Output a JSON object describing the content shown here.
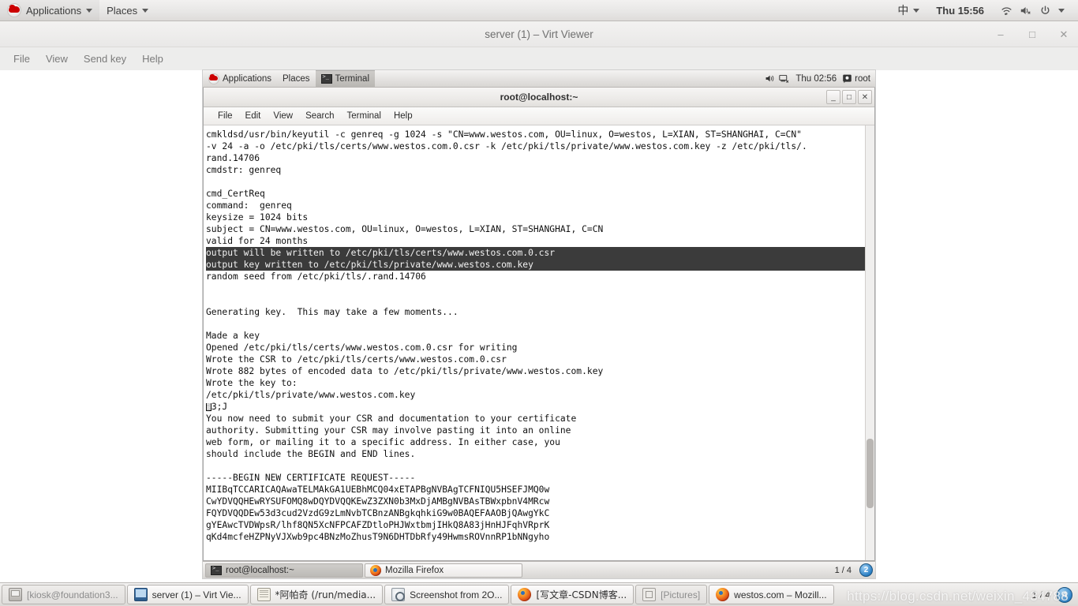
{
  "host_panel": {
    "logo_icon": "redhat-logo-icon",
    "applications_label": "Applications",
    "places_label": "Places",
    "input_method": "中",
    "clock": "Thu 15:56",
    "wifi_icon": "wifi-icon",
    "volume_icon": "volume-muted-icon",
    "power_icon": "power-icon"
  },
  "virt_viewer": {
    "title": "server (1) – Virt Viewer",
    "menu": [
      "File",
      "View",
      "Send key",
      "Help"
    ],
    "window_controls": {
      "minimize": "–",
      "maximize": "□",
      "close": "✕"
    }
  },
  "guest_panel": {
    "applications_label": "Applications",
    "places_label": "Places",
    "active_app": "Terminal",
    "volume_icon": "volume-icon",
    "network_icon": "network-disconnected-icon",
    "clock": "Thu 02:56",
    "user_icon": "user-icon",
    "user": "root"
  },
  "terminal": {
    "title": "root@localhost:~",
    "menu": [
      "File",
      "Edit",
      "View",
      "Search",
      "Terminal",
      "Help"
    ],
    "window_controls": {
      "minimize": "_",
      "maximize": "□",
      "close": "✕"
    },
    "lines": [
      {
        "text": "cmkldsd/usr/bin/keyutil -c genreq -g 1024 -s \"CN=www.westos.com, OU=linux, O=westos, L=XIAN, ST=SHANGHAI, C=CN\"",
        "selected": false
      },
      {
        "text": "-v 24 -a -o /etc/pki/tls/certs/www.westos.com.0.csr -k /etc/pki/tls/private/www.westos.com.key -z /etc/pki/tls/.",
        "selected": false
      },
      {
        "text": "rand.14706",
        "selected": false
      },
      {
        "text": "cmdstr: genreq",
        "selected": false
      },
      {
        "text": "",
        "selected": false
      },
      {
        "text": "cmd_CertReq",
        "selected": false
      },
      {
        "text": "command:  genreq",
        "selected": false
      },
      {
        "text": "keysize = 1024 bits",
        "selected": false
      },
      {
        "text": "subject = CN=www.westos.com, OU=linux, O=westos, L=XIAN, ST=SHANGHAI, C=CN",
        "selected": false
      },
      {
        "text": "valid for 24 months",
        "selected": false
      },
      {
        "text": "output will be written to /etc/pki/tls/certs/www.westos.com.0.csr",
        "selected": true
      },
      {
        "text": "output key written to /etc/pki/tls/private/www.westos.com.key",
        "selected": true
      },
      {
        "text": "random seed from /etc/pki/tls/.rand.14706",
        "selected": false
      },
      {
        "text": "",
        "selected": false
      },
      {
        "text": "",
        "selected": false
      },
      {
        "text": "Generating key.  This may take a few moments...",
        "selected": false
      },
      {
        "text": "",
        "selected": false
      },
      {
        "text": "Made a key",
        "selected": false
      },
      {
        "text": "Opened /etc/pki/tls/certs/www.westos.com.0.csr for writing",
        "selected": false
      },
      {
        "text": "Wrote the CSR to /etc/pki/tls/certs/www.westos.com.0.csr",
        "selected": false
      },
      {
        "text": "Wrote 882 bytes of encoded data to /etc/pki/tls/private/www.westos.com.key",
        "selected": false
      },
      {
        "text": "Wrote the key to:",
        "selected": false
      },
      {
        "text": "/etc/pki/tls/private/www.westos.com.key",
        "selected": false
      },
      {
        "text": "\u00003;J",
        "selected": false,
        "ctrl_prefix": true
      },
      {
        "text": "You now need to submit your CSR and documentation to your certificate",
        "selected": false
      },
      {
        "text": "authority. Submitting your CSR may involve pasting it into an online",
        "selected": false
      },
      {
        "text": "web form, or mailing it to a specific address. In either case, you",
        "selected": false
      },
      {
        "text": "should include the BEGIN and END lines.",
        "selected": false
      },
      {
        "text": "",
        "selected": false
      },
      {
        "text": "-----BEGIN NEW CERTIFICATE REQUEST-----",
        "selected": false
      },
      {
        "text": "MIIBqTCCARICAQAwaTELMAkGA1UEBhMCQ04xETAPBgNVBAgTCFNIQU5HSEFJMQ0w",
        "selected": false
      },
      {
        "text": "CwYDVQQHEwRYSUFOMQ8wDQYDVQQKEwZ3ZXN0b3MxDjAMBgNVBAsTBWxpbnV4MRcw",
        "selected": false
      },
      {
        "text": "FQYDVQQDEw53d3cud2VzdG9zLmNvbTCBnzANBgkqhkiG9w0BAQEFAAOBjQAwgYkC",
        "selected": false
      },
      {
        "text": "gYEAwcTVDWpsR/lhf8QN5XcNFPCAFZDtloPHJWxtbmjIHkQ8A83jHnHJFqhVRprK",
        "selected": false
      },
      {
        "text": "qKd4mcfeHZPNyVJXwb9pc4BNzMoZhusT9N6DHTDbRfy49HwmsROVnnRP1bNNgyho",
        "selected": false
      }
    ],
    "ctrl_char_label": "▓"
  },
  "guest_taskbar": {
    "tasks": [
      {
        "label": "root@localhost:~",
        "icon": "terminal-icon",
        "active": true
      },
      {
        "label": "Mozilla Firefox",
        "icon": "firefox-icon",
        "active": false
      }
    ],
    "workspace_count": "1 / 4",
    "workspace_badge": "2"
  },
  "host_taskbar": {
    "tasks": [
      {
        "label": "[kiosk@foundation3...",
        "icon": "terminal-kiosk-icon",
        "dim": true
      },
      {
        "label": "server (1) – Virt Vie...",
        "icon": "monitor-icon",
        "dim": false
      },
      {
        "label": "*阿帕奇 (/run/media...",
        "icon": "text-editor-icon",
        "dim": false
      },
      {
        "label": "Screenshot from 2O...",
        "icon": "screenshot-icon",
        "dim": false
      },
      {
        "label": "[写文章-CSDN博客...",
        "icon": "firefox-icon",
        "dim": false
      },
      {
        "label": "[Pictures]",
        "icon": "file-manager-icon",
        "dim": true
      },
      {
        "label": "westos.com – Mozill...",
        "icon": "firefox-icon",
        "dim": false
      }
    ],
    "workspace_count": "1 / 4",
    "workspace_badge": "4"
  },
  "watermark": {
    "text": "https://blog.csdn.net/weixin_434788"
  },
  "colors": {
    "panel_bg": "#e8e7e6",
    "terminal_bg": "#ffffff",
    "terminal_fg": "#101010",
    "selection_bg": "#3b3b3b",
    "accent_blue": "#2f84c8",
    "redhat_red": "#cc0000"
  }
}
